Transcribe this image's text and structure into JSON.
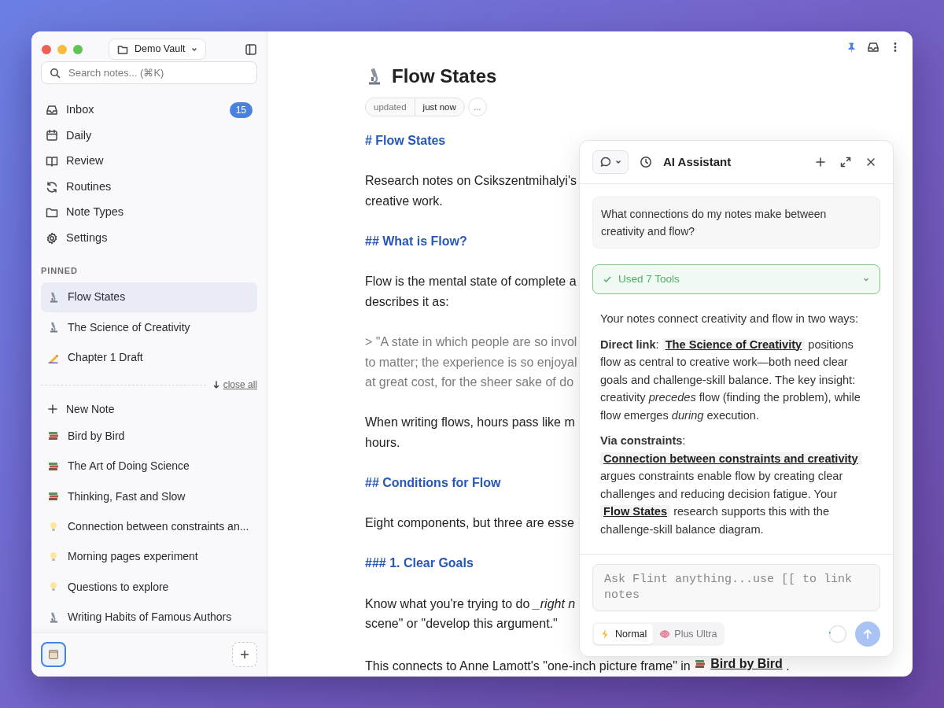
{
  "sidebar": {
    "vault": "Demo Vault",
    "search": {
      "placeholder": "Search notes... (⌘K)"
    },
    "nav": [
      {
        "kind": "inbox",
        "label": "Inbox",
        "count": "15"
      },
      {
        "kind": "daily",
        "label": "Daily"
      },
      {
        "kind": "review",
        "label": "Review"
      },
      {
        "kind": "routines",
        "label": "Routines"
      },
      {
        "kind": "types",
        "label": "Note Types"
      },
      {
        "kind": "settings",
        "label": "Settings"
      }
    ],
    "pinned_label": "PINNED",
    "pinned": [
      {
        "kind": "research",
        "label": "Flow States",
        "selected": true
      },
      {
        "kind": "research",
        "label": "The Science of Creativity",
        "selected": false
      },
      {
        "kind": "draft",
        "label": "Chapter 1 Draft",
        "selected": false
      }
    ],
    "close_all": "close all",
    "new_note": "New Note",
    "notes": [
      {
        "kind": "book",
        "label": "Bird by Bird"
      },
      {
        "kind": "book",
        "label": "The Art of Doing Science"
      },
      {
        "kind": "book",
        "label": "Thinking, Fast and Slow"
      },
      {
        "kind": "idea",
        "label": "Connection between constraints an..."
      },
      {
        "kind": "idea",
        "label": "Morning pages experiment"
      },
      {
        "kind": "idea",
        "label": "Questions to explore"
      },
      {
        "kind": "research",
        "label": "Writing Habits of Famous Authors"
      }
    ],
    "bottom_bar": {
      "views": [
        {
          "selected": true
        }
      ]
    }
  },
  "editor": {
    "title": "Flow States",
    "meta": {
      "label": "updated",
      "value": "just now",
      "more": "..."
    },
    "blocks": [
      {
        "kind": "h1",
        "lines": [
          "# Flow States"
        ]
      },
      {
        "kind": "p",
        "lines": [
          "Research notes on Csikszentmihalyi's",
          "creative work."
        ]
      },
      {
        "kind": "h2",
        "lines": [
          "## What is Flow?"
        ]
      },
      {
        "kind": "p",
        "lines": [
          "Flow is the mental state of complete a",
          "describes it as:"
        ]
      },
      {
        "kind": "quote",
        "lines": [
          "> \"A state in which people are so invol",
          "to matter; the experience is so enjoyal",
          "at great cost, for the sheer sake of do"
        ]
      },
      {
        "kind": "p",
        "lines": [
          "When writing flows, hours pass like m",
          "hours."
        ]
      },
      {
        "kind": "h2",
        "lines": [
          "## Conditions for Flow"
        ]
      },
      {
        "kind": "p",
        "lines": [
          "Eight components, but three are esse"
        ]
      },
      {
        "kind": "h3",
        "lines": [
          "### 1. Clear Goals"
        ]
      },
      {
        "kind": "p",
        "lines": [
          "Know what you're trying to do *_right n*",
          "scene\" or \"develop this argument.\""
        ]
      },
      {
        "kind": "ref",
        "text": "This connects to Anne Lamott's \"one-inch picture frame\" in",
        "link": "Bird by Bird",
        "after": "."
      }
    ]
  },
  "assistant": {
    "title": "AI Assistant",
    "question": "What connections do my notes make between creativity and flow?",
    "tools": {
      "label": "Used 7 Tools",
      "expanded": false
    },
    "answer": [
      [
        {
          "kind": "text",
          "text": "Your notes connect creativity and flow in two ways:"
        }
      ],
      [
        {
          "kind": "text",
          "text": "**Direct link**: "
        },
        {
          "kind": "link",
          "text": "The Science of Creativity"
        },
        {
          "kind": "text",
          "text": " positions flow as central to creative work—both need clear goals and challenge-skill balance. The key insight: creativity *precedes* flow (finding the problem), while flow emerges *during* execution."
        }
      ],
      [
        {
          "kind": "text",
          "text": "**Via constraints**: "
        },
        {
          "kind": "link",
          "text": "Connection between constraints and creativity"
        },
        {
          "kind": "text",
          "text": " argues constraints enable flow by creating clear challenges and reducing decision fatigue. Your "
        },
        {
          "kind": "link",
          "text": "Flow States"
        },
        {
          "kind": "text",
          "text": " research supports this with the challenge-skill balance diagram."
        }
      ]
    ],
    "input": {
      "placeholder": "Ask Flint anything...use [[ to link notes"
    },
    "modes": [
      {
        "kind": "fast",
        "label": "Normal",
        "selected": true
      },
      {
        "kind": "deep",
        "label": "Plus Ultra",
        "selected": false
      }
    ],
    "send_disabled": true
  }
}
